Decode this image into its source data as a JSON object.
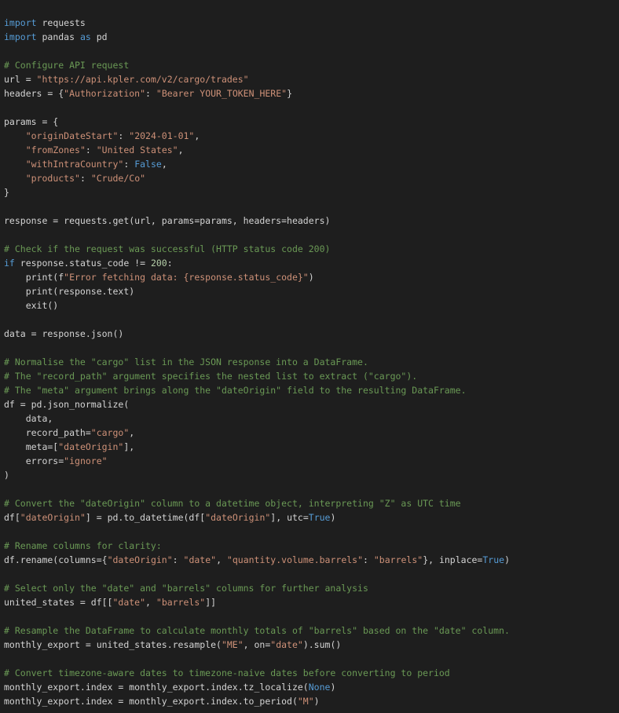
{
  "editor": {
    "language": "python",
    "colors": {
      "background": "#1e1e1e",
      "text": "#d4d4d4",
      "keyword": "#569cd6",
      "string": "#ce9178",
      "comment": "#6a9955",
      "number": "#b5cea8"
    },
    "lines": [
      [
        [
          "kw",
          "import"
        ],
        [
          "t",
          " requests"
        ]
      ],
      [
        [
          "kw",
          "import"
        ],
        [
          "t",
          " pandas "
        ],
        [
          "kw",
          "as"
        ],
        [
          "t",
          " pd"
        ]
      ],
      [],
      [
        [
          "cm",
          "# Configure API request"
        ]
      ],
      [
        [
          "t",
          "url = "
        ],
        [
          "str",
          "\"https://api.kpler.com/v2/cargo/trades\""
        ]
      ],
      [
        [
          "t",
          "headers = {"
        ],
        [
          "str",
          "\"Authorization\""
        ],
        [
          "t",
          ": "
        ],
        [
          "str",
          "\"Bearer YOUR_TOKEN_HERE\""
        ],
        [
          "t",
          "}"
        ]
      ],
      [],
      [
        [
          "t",
          "params = {"
        ]
      ],
      [
        [
          "t",
          "    "
        ],
        [
          "str",
          "\"originDateStart\""
        ],
        [
          "t",
          ": "
        ],
        [
          "str",
          "\"2024-01-01\""
        ],
        [
          "t",
          ","
        ]
      ],
      [
        [
          "t",
          "    "
        ],
        [
          "str",
          "\"fromZones\""
        ],
        [
          "t",
          ": "
        ],
        [
          "str",
          "\"United States\""
        ],
        [
          "t",
          ","
        ]
      ],
      [
        [
          "t",
          "    "
        ],
        [
          "str",
          "\"withIntraCountry\""
        ],
        [
          "t",
          ": "
        ],
        [
          "kw",
          "False"
        ],
        [
          "t",
          ","
        ]
      ],
      [
        [
          "t",
          "    "
        ],
        [
          "str",
          "\"products\""
        ],
        [
          "t",
          ": "
        ],
        [
          "str",
          "\"Crude/Co\""
        ]
      ],
      [
        [
          "t",
          "}"
        ]
      ],
      [],
      [
        [
          "t",
          "response = requests.get(url, params=params, headers=headers)"
        ]
      ],
      [],
      [
        [
          "cm",
          "# Check if the request was successful (HTTP status code 200)"
        ]
      ],
      [
        [
          "kw",
          "if"
        ],
        [
          "t",
          " response.status_code != "
        ],
        [
          "num",
          "200"
        ],
        [
          "t",
          ":"
        ]
      ],
      [
        [
          "t",
          "    print(f"
        ],
        [
          "str",
          "\"Error fetching data: {response.status_code}\""
        ],
        [
          "t",
          ")"
        ]
      ],
      [
        [
          "t",
          "    print(response.text)"
        ]
      ],
      [
        [
          "t",
          "    exit()"
        ]
      ],
      [],
      [
        [
          "t",
          "data = response.json()"
        ]
      ],
      [],
      [
        [
          "cm",
          "# Normalise the \"cargo\" list in the JSON response into a DataFrame."
        ]
      ],
      [
        [
          "cm",
          "# The \"record_path\" argument specifies the nested list to extract (\"cargo\")."
        ]
      ],
      [
        [
          "cm",
          "# The \"meta\" argument brings along the \"dateOrigin\" field to the resulting DataFrame."
        ]
      ],
      [
        [
          "t",
          "df = pd.json_normalize("
        ]
      ],
      [
        [
          "t",
          "    data,"
        ]
      ],
      [
        [
          "t",
          "    record_path="
        ],
        [
          "str",
          "\"cargo\""
        ],
        [
          "t",
          ","
        ]
      ],
      [
        [
          "t",
          "    meta=["
        ],
        [
          "str",
          "\"dateOrigin\""
        ],
        [
          "t",
          "],"
        ]
      ],
      [
        [
          "t",
          "    errors="
        ],
        [
          "str",
          "\"ignore\""
        ]
      ],
      [
        [
          "t",
          ")"
        ]
      ],
      [],
      [
        [
          "cm",
          "# Convert the \"dateOrigin\" column to a datetime object, interpreting \"Z\" as UTC time"
        ]
      ],
      [
        [
          "t",
          "df["
        ],
        [
          "str",
          "\"dateOrigin\""
        ],
        [
          "t",
          "] = pd.to_datetime(df["
        ],
        [
          "str",
          "\"dateOrigin\""
        ],
        [
          "t",
          "], utc="
        ],
        [
          "kw",
          "True"
        ],
        [
          "t",
          ")"
        ]
      ],
      [],
      [
        [
          "cm",
          "# Rename columns for clarity:"
        ]
      ],
      [
        [
          "t",
          "df.rename(columns={"
        ],
        [
          "str",
          "\"dateOrigin\""
        ],
        [
          "t",
          ": "
        ],
        [
          "str",
          "\"date\""
        ],
        [
          "t",
          ", "
        ],
        [
          "str",
          "\"quantity.volume.barrels\""
        ],
        [
          "t",
          ": "
        ],
        [
          "str",
          "\"barrels\""
        ],
        [
          "t",
          "}, inplace="
        ],
        [
          "kw",
          "True"
        ],
        [
          "t",
          ")"
        ]
      ],
      [],
      [
        [
          "cm",
          "# Select only the \"date\" and \"barrels\" columns for further analysis"
        ]
      ],
      [
        [
          "t",
          "united_states = df[["
        ],
        [
          "str",
          "\"date\""
        ],
        [
          "t",
          ", "
        ],
        [
          "str",
          "\"barrels\""
        ],
        [
          "t",
          "]]"
        ]
      ],
      [],
      [
        [
          "cm",
          "# Resample the DataFrame to calculate monthly totals of \"barrels\" based on the \"date\" column."
        ]
      ],
      [
        [
          "t",
          "monthly_export = united_states.resample("
        ],
        [
          "str",
          "\"ME\""
        ],
        [
          "t",
          ", on="
        ],
        [
          "str",
          "\"date\""
        ],
        [
          "t",
          ").sum()"
        ]
      ],
      [],
      [
        [
          "cm",
          "# Convert timezone-aware dates to timezone-naive dates before converting to period"
        ]
      ],
      [
        [
          "t",
          "monthly_export.index = monthly_export.index.tz_localize("
        ],
        [
          "kw",
          "None"
        ],
        [
          "t",
          ")"
        ]
      ],
      [
        [
          "t",
          "monthly_export.index = monthly_export.index.to_period("
        ],
        [
          "str",
          "\"M\""
        ],
        [
          "t",
          ")"
        ]
      ]
    ]
  }
}
